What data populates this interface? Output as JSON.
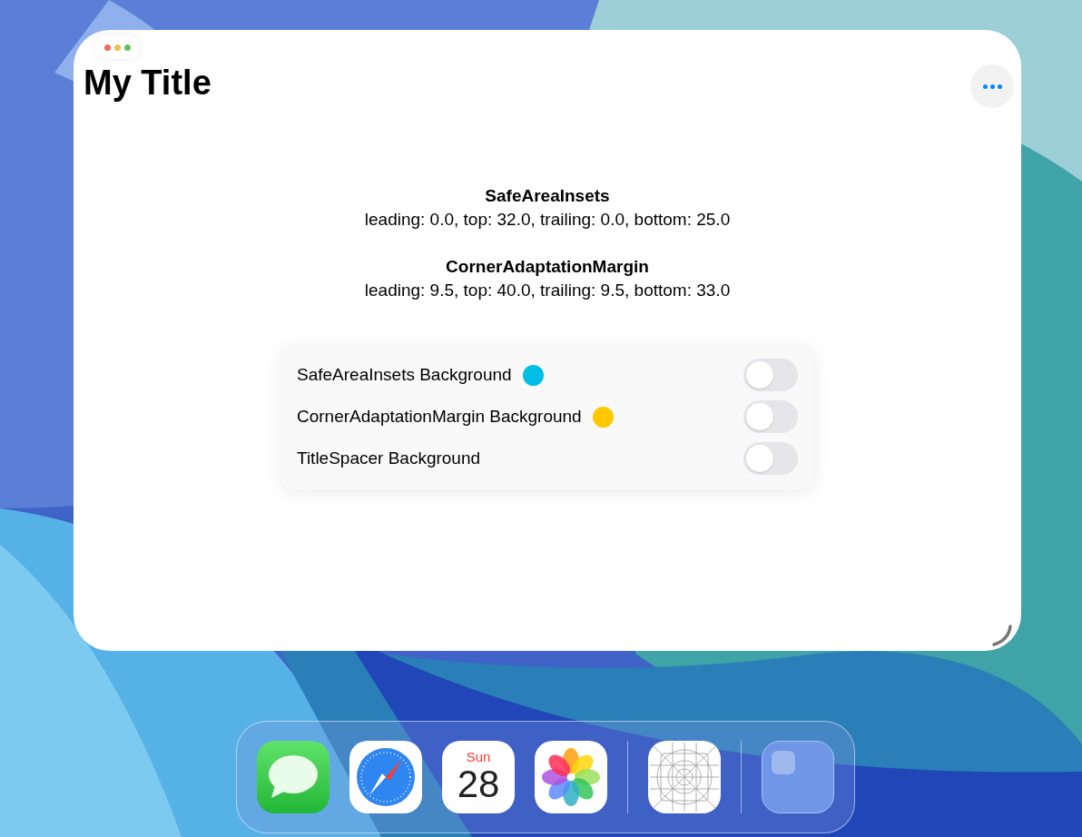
{
  "window": {
    "title": "My Title"
  },
  "sections": [
    {
      "title": "SafeAreaInsets",
      "body": "leading: 0.0, top: 32.0, trailing: 0.0, bottom: 25.0"
    },
    {
      "title": "CornerAdaptationMargin",
      "body": "leading: 9.5, top: 40.0, trailing: 9.5, bottom: 33.0"
    }
  ],
  "toggles": [
    {
      "label": "SafeAreaInsets Background",
      "color": "#00bfe6",
      "on": false
    },
    {
      "label": "CornerAdaptationMargin Background",
      "color": "#ffc800",
      "on": false
    },
    {
      "label": "TitleSpacer Background",
      "on": false
    }
  ],
  "dock": {
    "groups": [
      [
        {
          "kind": "messages"
        },
        {
          "kind": "compass"
        },
        {
          "kind": "calendar",
          "weekday": "Sun",
          "day": "28"
        },
        {
          "kind": "photos"
        }
      ],
      [
        {
          "kind": "grid"
        }
      ],
      [
        {
          "kind": "folder"
        }
      ]
    ]
  }
}
